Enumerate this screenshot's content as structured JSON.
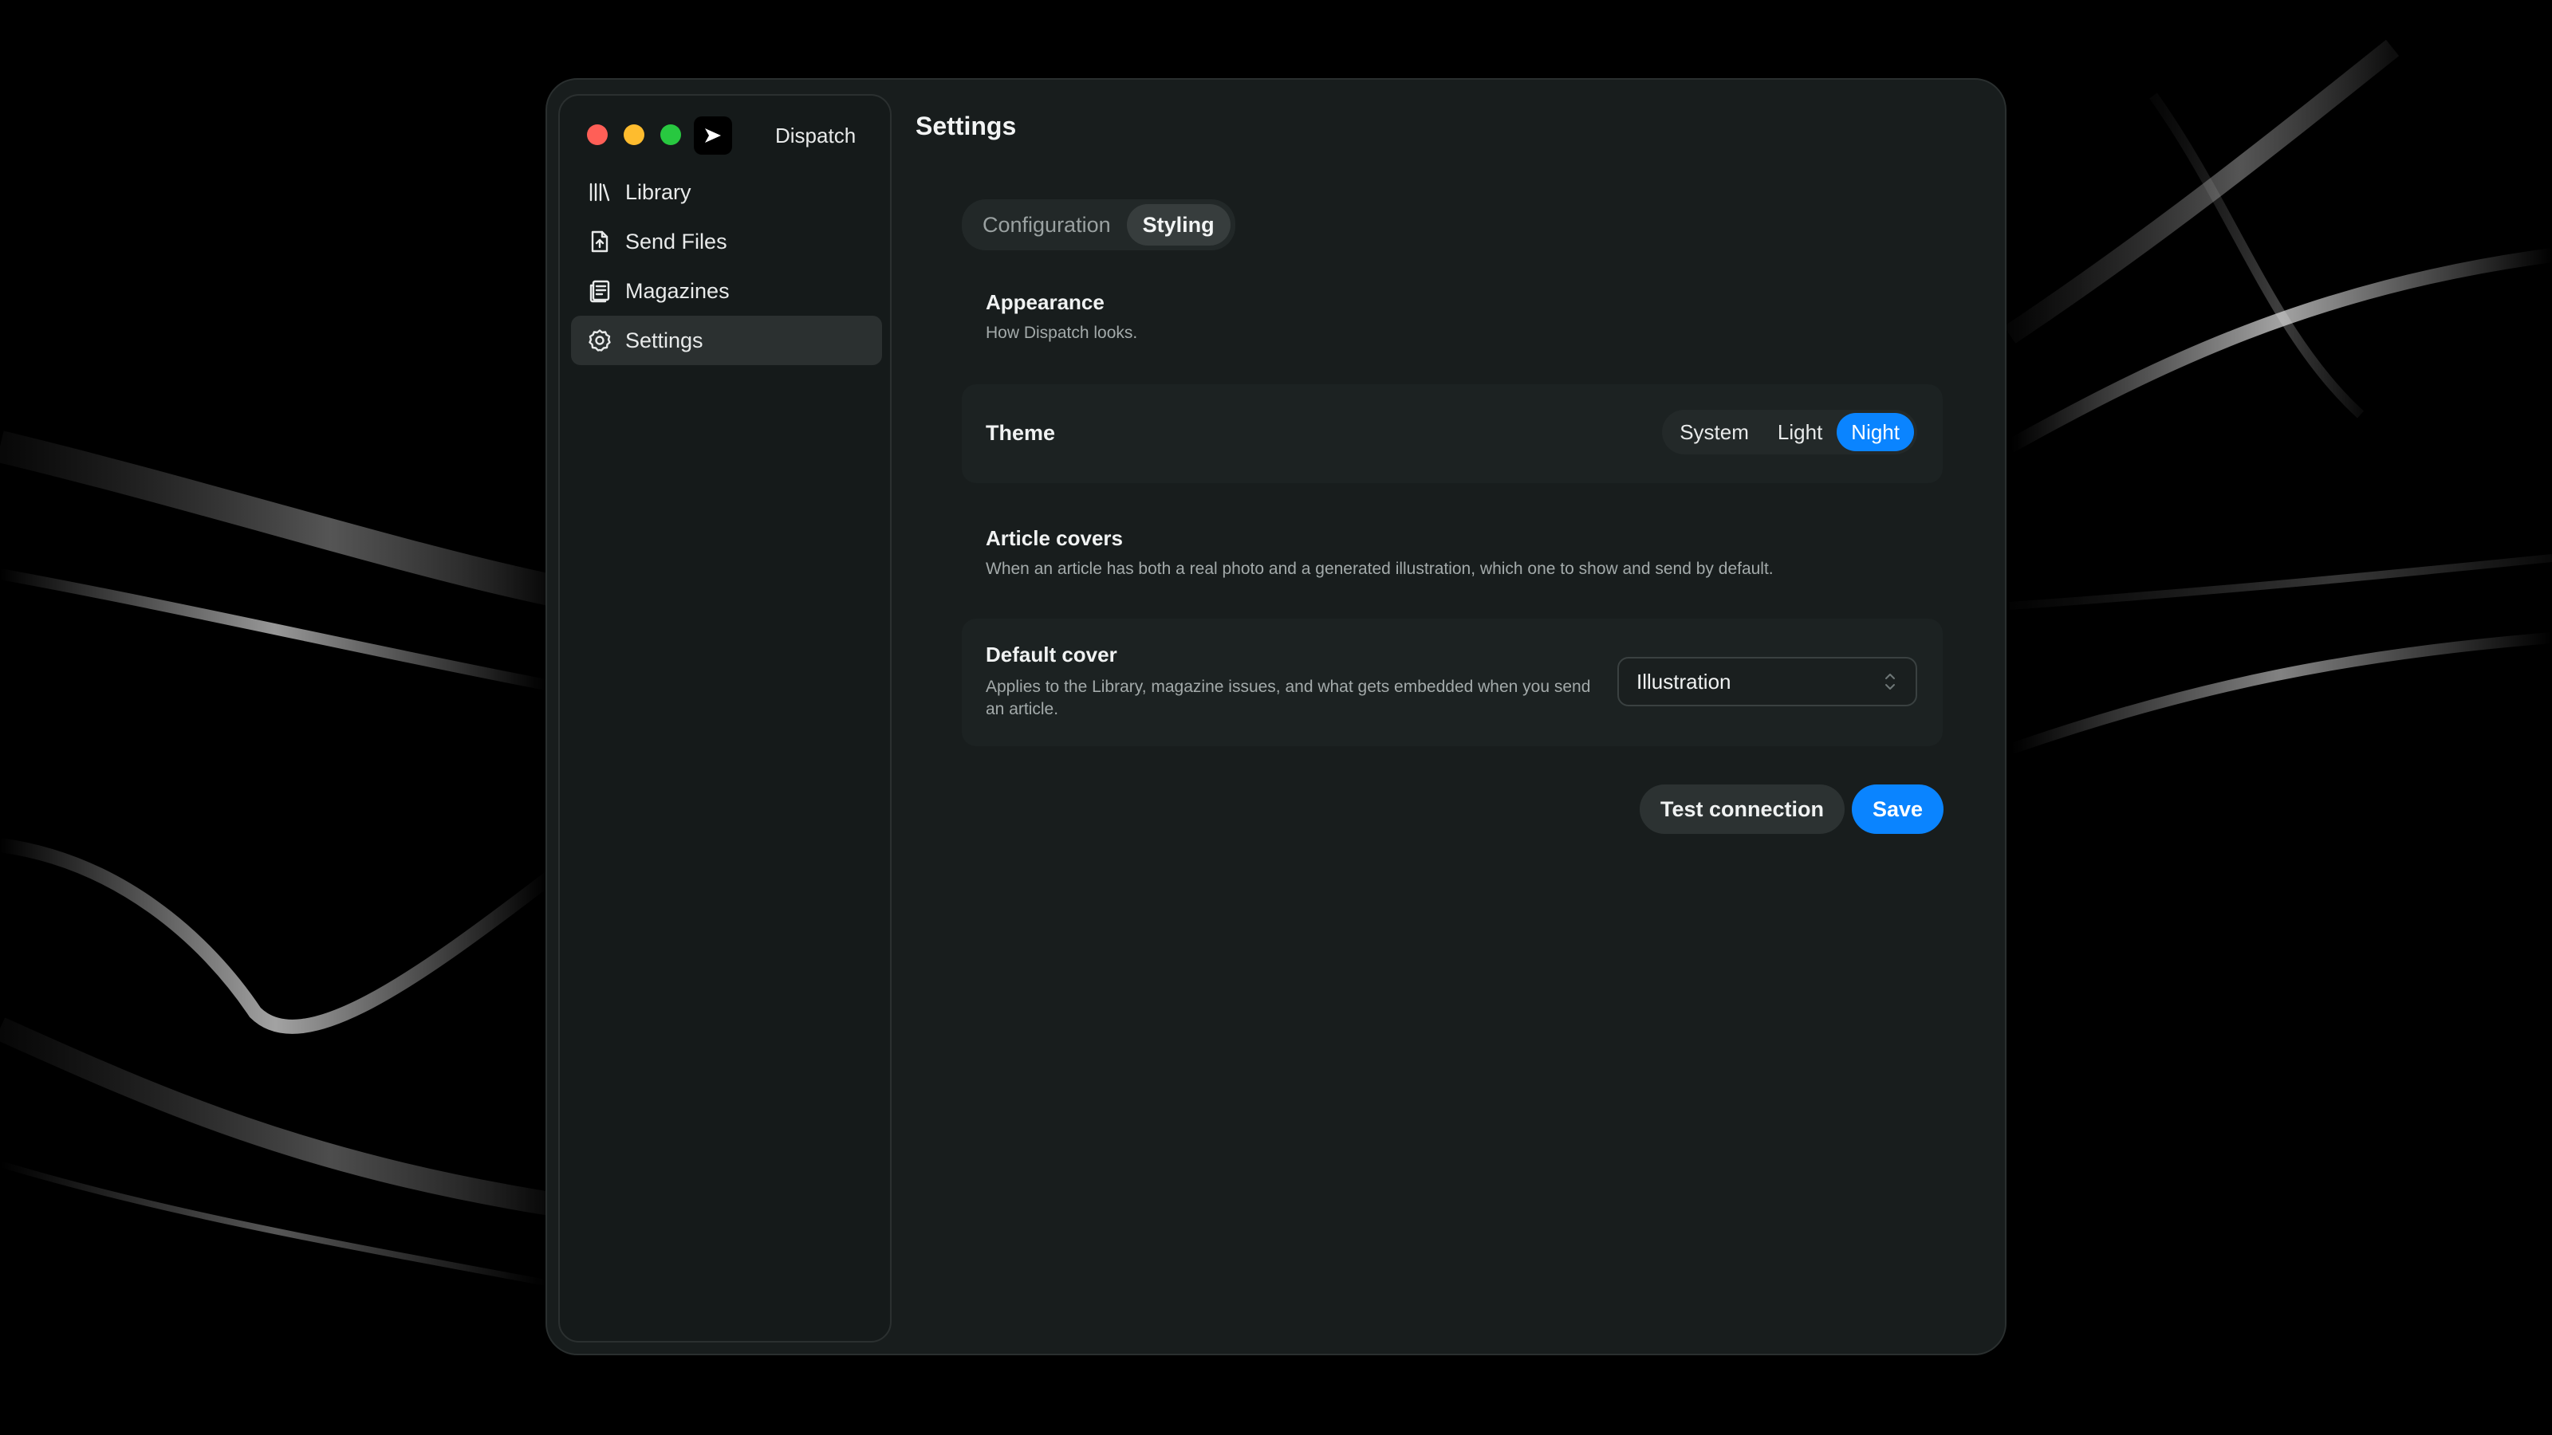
{
  "window": {
    "app_name": "Dispatch",
    "page_title": "Settings"
  },
  "sidebar": {
    "items": [
      {
        "label": "Library",
        "icon": "library-icon"
      },
      {
        "label": "Send Files",
        "icon": "send-file-icon"
      },
      {
        "label": "Magazines",
        "icon": "magazine-icon"
      },
      {
        "label": "Settings",
        "icon": "gear-icon",
        "active": true
      }
    ]
  },
  "tabs": [
    {
      "label": "Configuration"
    },
    {
      "label": "Styling",
      "active": true
    }
  ],
  "appearance": {
    "title": "Appearance",
    "description": "How Dispatch looks.",
    "theme_label": "Theme",
    "theme_options": [
      "System",
      "Light",
      "Night"
    ],
    "theme_selected": "Night"
  },
  "article_covers": {
    "title": "Article covers",
    "description": "When an article has both a real photo and a generated illustration, which one to show and send by default.",
    "default_cover_label": "Default cover",
    "default_cover_description": "Applies to the Library, magazine issues, and what gets embedded when you send an article.",
    "default_cover_value": "Illustration"
  },
  "actions": {
    "test_label": "Test connection",
    "save_label": "Save"
  },
  "colors": {
    "accent": "#0a84ff",
    "window_bg": "#181d1d",
    "sidebar_bg": "#151a1a",
    "close": "#ff5f57",
    "minimize": "#febc2e",
    "zoom": "#28c840"
  }
}
